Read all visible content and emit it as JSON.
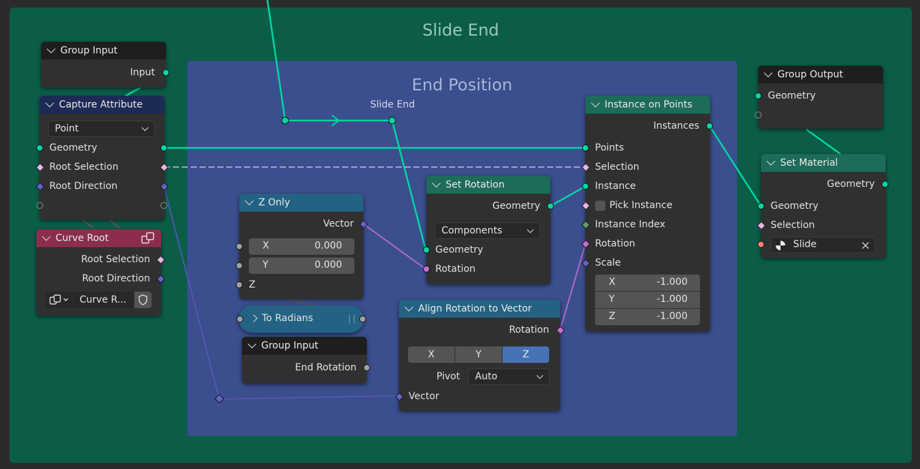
{
  "frames": {
    "outer_title": "Slide End",
    "inner_title": "End Position",
    "reroute_label": "Slide End"
  },
  "nodes": {
    "group_input_top": {
      "title": "Group Input",
      "output": "Input"
    },
    "capture_attribute": {
      "title": "Capture Attribute",
      "domain": "Point",
      "rows": [
        "Geometry",
        "Root Selection",
        "Root Direction"
      ]
    },
    "curve_root": {
      "title": "Curve Root",
      "outputs": [
        "Root Selection",
        "Root Direction"
      ],
      "datablock": "Curve R..."
    },
    "z_only": {
      "title": "Z Only",
      "output": "Vector",
      "x_label": "X",
      "x_value": "0.000",
      "y_label": "Y",
      "y_value": "0.000",
      "z_label": "Z"
    },
    "to_radians": {
      "title": "To Radians"
    },
    "group_input_bottom": {
      "title": "Group Input",
      "output": "End Rotation"
    },
    "set_rotation": {
      "title": "Set Rotation",
      "output": "Geometry",
      "mode": "Components",
      "inputs": [
        "Geometry",
        "Rotation"
      ]
    },
    "align_rotation": {
      "title": "Align Rotation to Vector",
      "output": "Rotation",
      "axes": [
        "X",
        "Y",
        "Z"
      ],
      "active_axis": "Z",
      "pivot_label": "Pivot",
      "pivot_value": "Auto",
      "input": "Vector"
    },
    "instance_on_points": {
      "title": "Instance on Points",
      "output": "Instances",
      "inputs": [
        "Points",
        "Selection",
        "Instance",
        "Pick Instance",
        "Instance Index",
        "Rotation",
        "Scale"
      ],
      "scale": [
        {
          "label": "X",
          "value": "-1.000"
        },
        {
          "label": "Y",
          "value": "-1.000"
        },
        {
          "label": "Z",
          "value": "-1.000"
        }
      ]
    },
    "group_output": {
      "title": "Group Output",
      "input": "Geometry"
    },
    "set_material": {
      "title": "Set Material",
      "output": "Geometry",
      "inputs": [
        "Geometry",
        "Selection"
      ],
      "material": "Slide"
    }
  },
  "colors": {
    "geometry_socket": "#00d6a3",
    "attribute_header": "#1e2a56",
    "geometry_header": "#1d6b59",
    "input_header": "#1e1e1e",
    "utility_header": "#246283",
    "curve_root_header": "#8a2e4b",
    "outer_frame": "#0b5d48",
    "inner_frame": "#3b4e8d"
  }
}
